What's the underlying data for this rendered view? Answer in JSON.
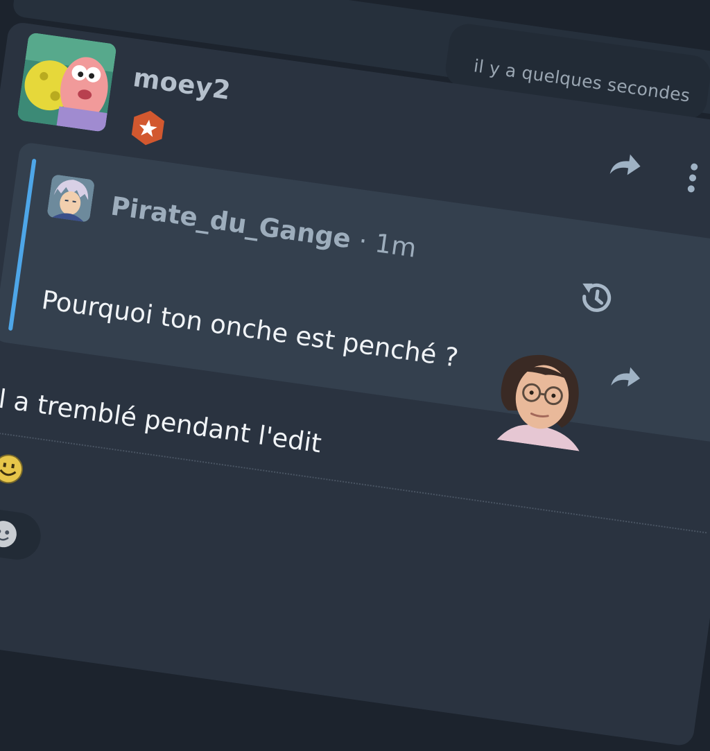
{
  "post": {
    "timestamp": "il y a quelques secondes",
    "author": {
      "username": "moey2"
    },
    "quote": {
      "author": "Pirate_du_Gange",
      "separator": "·",
      "time": "1m",
      "text": "Pourquoi ton onche est penché ?"
    },
    "reply_text": "il a tremblé pendant l'edit"
  },
  "icons": {
    "share": "share-arrow-icon",
    "more": "more-vertical-icon",
    "history": "history-icon",
    "quote_share": "share-arrow-icon",
    "badge": "star-badge-icon",
    "reaction": "smiley-icon",
    "add_reaction": "add-reaction-icon"
  },
  "colors": {
    "accent": "#4ea6e8",
    "badge": "#d2582f",
    "card": "#2a3340",
    "quote_bg": "#34404e"
  }
}
